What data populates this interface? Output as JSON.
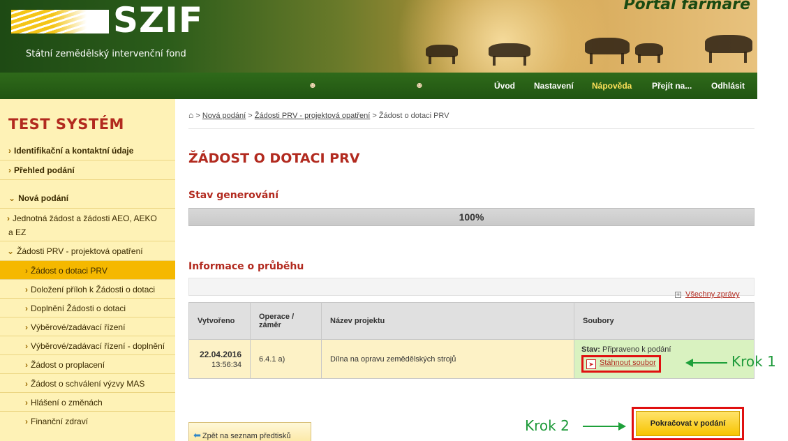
{
  "header": {
    "logo_text": "SZIF",
    "logo_subtitle": "Státní zemědělský intervenční fond",
    "portal_title": "Portál farmáře"
  },
  "nav": {
    "items": [
      "Úvod",
      "Nastavení",
      "Nápověda",
      "Přejít na...",
      "Odhlásit"
    ]
  },
  "sidebar": {
    "title": "TEST SYSTÉM",
    "items": [
      {
        "label": "Identifikační a kontaktní údaje"
      },
      {
        "label": "Přehled podání"
      },
      {
        "label": "Nová podání"
      },
      {
        "label": "Jednotná žádost a žádosti AEO, AEKO"
      },
      {
        "label": "a EZ"
      },
      {
        "label": "Žádosti PRV - projektová opatření"
      },
      {
        "label": "Žádost o dotaci PRV"
      },
      {
        "label": "Doložení příloh k Žádosti o dotaci"
      },
      {
        "label": "Doplnění Žádosti o dotaci"
      },
      {
        "label": "Výběrové/zadávací řízení"
      },
      {
        "label": "Výběrové/zadávací řízení - doplnění"
      },
      {
        "label": "Žádost o proplacení"
      },
      {
        "label": "Žádost o schválení výzvy MAS"
      },
      {
        "label": "Hlášení o změnách"
      },
      {
        "label": "Finanční zdraví"
      }
    ]
  },
  "breadcrumb": {
    "items": [
      "Nová podání",
      "Žádosti PRV - projektová opatření",
      "Žádost o dotaci PRV"
    ],
    "separator": ">"
  },
  "page": {
    "title": "ŽÁDOST O DOTACI PRV",
    "generation_section": "Stav generování",
    "progress_label": "100%",
    "progress_value": 100,
    "progress_section": "Informace o průběhu",
    "all_messages_link": "Všechny zprávy"
  },
  "table": {
    "headers": [
      "Vytvořeno",
      "Operace / záměr",
      "Název projektu",
      "Soubory"
    ],
    "rows": [
      {
        "date": "22.04.2016",
        "time": "13:56:34",
        "operation": "6.4.1 a)",
        "project_name": "Dílna na opravu zemědělských strojů",
        "status_label": "Stav:",
        "status_value": "Připraveno k podání",
        "download_label": "Stáhnout soubor"
      }
    ]
  },
  "annotations": {
    "step1": "Krok 1",
    "step2": "Krok 2"
  },
  "buttons": {
    "back": "Zpět na seznam předtisků",
    "continue": "Pokračovat v podání"
  },
  "colors": {
    "accent_red": "#b22a1f",
    "nav_green": "#215512",
    "sidebar_yellow": "#fef2b6",
    "sidebar_active": "#f5b800",
    "annotation_green": "#1e9a3a",
    "highlight_red": "#e01010"
  }
}
